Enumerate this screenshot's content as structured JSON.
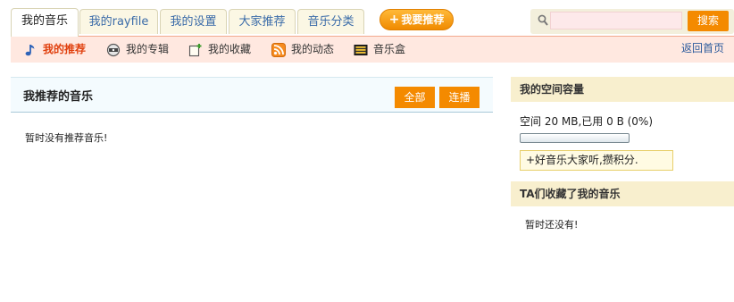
{
  "tabs": [
    {
      "label": "我的音乐",
      "active": true
    },
    {
      "label": "我的rayfile",
      "active": false
    },
    {
      "label": "我的设置",
      "active": false
    },
    {
      "label": "大家推荐",
      "active": false
    },
    {
      "label": "音乐分类",
      "active": false
    }
  ],
  "recommend_button": {
    "label": "我要推荐",
    "icon": "plus-icon"
  },
  "search": {
    "placeholder": "",
    "value": "",
    "button_label": "搜索",
    "icon": "search-icon"
  },
  "subnav": {
    "items": [
      {
        "label": "我的推荐",
        "icon": "music-note-icon",
        "active": true
      },
      {
        "label": "我的专辑",
        "icon": "cd-album-icon",
        "active": false
      },
      {
        "label": "我的收藏",
        "icon": "favorites-add-icon",
        "active": false
      },
      {
        "label": "我的动态",
        "icon": "rss-feed-icon",
        "active": false
      },
      {
        "label": "音乐盒",
        "icon": "music-box-icon",
        "active": false
      }
    ],
    "back_home": "返回首页"
  },
  "main": {
    "title": "我推荐的音乐",
    "buttons": {
      "all": "全部",
      "continuous": "连播"
    },
    "empty_message": "暂时没有推荐音乐!"
  },
  "sidebar": {
    "capacity": {
      "title": "我的空间容量",
      "usage_text": "空间 20 MB,已用 0 B (0%)",
      "used_fraction": 0,
      "promo": "+好音乐大家听,攒积分."
    },
    "collected": {
      "title": "TA们收藏了我的音乐",
      "empty_message": "暂时还没有!"
    }
  },
  "colors": {
    "accent_orange": "#f48a00",
    "link_blue": "#2b5a9c",
    "subnav_bg": "#ffe8e0",
    "active_red": "#e0400e",
    "side_header_bg": "#f8efce"
  }
}
